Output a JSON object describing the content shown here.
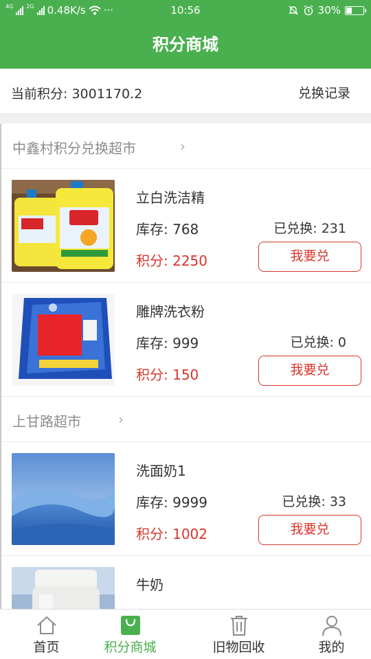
{
  "status_bar": {
    "network_1": "4G",
    "network_2": "2G",
    "speed": "0.48K/s",
    "more": "···",
    "time": "10:56",
    "battery": "30%",
    "battery_level": 0.3
  },
  "header": {
    "title": "积分商城"
  },
  "points": {
    "label": "当前积分: 3001170.2",
    "record_link": "兑换记录"
  },
  "stores": [
    {
      "name": "中鑫村积分兑换超市",
      "chevron": "›",
      "items": [
        {
          "name": "立白洗洁精",
          "stock": "库存: 768",
          "exchanged": "已兑换: 231",
          "price": "积分: 2250",
          "button": "我要兑",
          "image": "dish-soap-image"
        },
        {
          "name": "雕牌洗衣粉",
          "stock": "库存: 999",
          "exchanged": "已兑换: 0",
          "price": "积分: 150",
          "button": "我要兑",
          "image": "laundry-powder-image"
        }
      ]
    },
    {
      "name": "上甘路超市",
      "chevron": "›",
      "items": [
        {
          "name": "洗面奶1",
          "stock": "库存: 9999",
          "exchanged": "已兑换: 33",
          "price": "积分: 1002",
          "button": "我要兑",
          "image": "blue-landscape-image"
        },
        {
          "name": "牛奶",
          "stock": "",
          "exchanged": "",
          "price": "",
          "button": "",
          "image": "milk-jar-image"
        }
      ]
    }
  ],
  "tabs": [
    {
      "label": "首页",
      "icon": "home-icon",
      "active": false
    },
    {
      "label": "积分商城",
      "icon": "shopping-bag-icon",
      "active": true
    },
    {
      "label": "旧物回收",
      "icon": "trash-can-icon",
      "active": false
    },
    {
      "label": "我的",
      "icon": "person-icon",
      "active": false
    }
  ],
  "colors": {
    "brand_green": "#4ab04f",
    "accent_red": "#d9352b"
  }
}
